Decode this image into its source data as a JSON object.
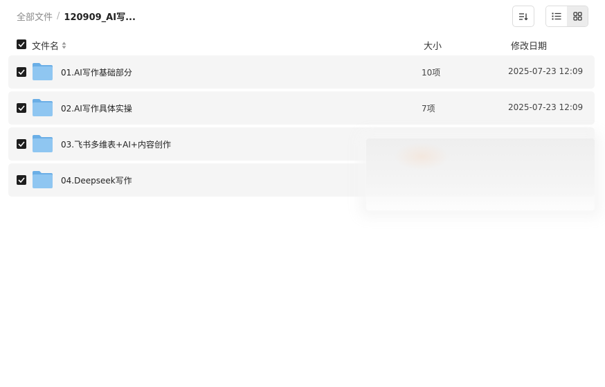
{
  "breadcrumb": {
    "root": "全部文件",
    "separator": "/",
    "current": "120909_AI写..."
  },
  "toolbar": {
    "sort_icon": "sort-icon",
    "list_view_icon": "list-view-icon",
    "grid_view_icon": "grid-view-icon"
  },
  "columns": {
    "name": "文件名",
    "size": "大小",
    "modified": "修改日期"
  },
  "rows": [
    {
      "name": "01.AI写作基础部分",
      "size": "10项",
      "modified": "2025-07-23 12:09",
      "checked": true
    },
    {
      "name": "02.AI写作具体实操",
      "size": "7项",
      "modified": "2025-07-23 12:09",
      "checked": true
    },
    {
      "name": "03.飞书多维表+AI+内容创作",
      "size": "",
      "modified": "",
      "checked": true
    },
    {
      "name": "04.Deepseek写作",
      "size": "",
      "modified": "",
      "checked": true
    }
  ],
  "colors": {
    "checkbox": "#1e1e1e",
    "row_bg": "#f5f5f5",
    "folder": "#7ab8ea"
  }
}
